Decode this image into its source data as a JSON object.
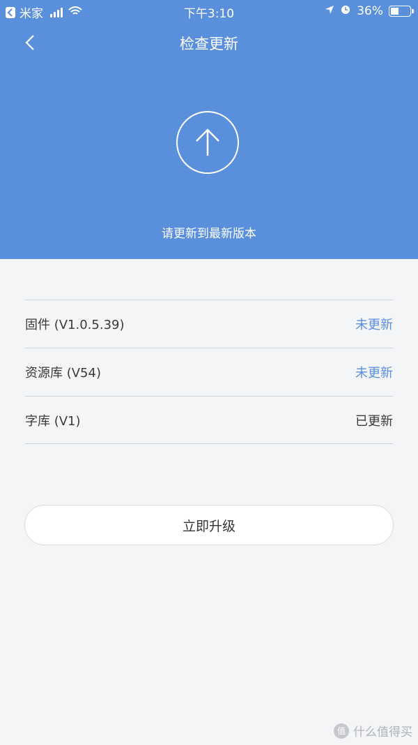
{
  "statusbar": {
    "back_app": "米家",
    "time": "下午3:10",
    "battery": "36%",
    "battery_level": 0.36
  },
  "nav": {
    "title": "检查更新"
  },
  "hero": {
    "hint": "请更新到最新版本"
  },
  "items": [
    {
      "name": "固件 (V1.0.5.39)",
      "status": "未更新",
      "updated": false
    },
    {
      "name": "资源库 (V54)",
      "status": "未更新",
      "updated": false
    },
    {
      "name": "字库 (V1)",
      "status": "已更新",
      "updated": true
    }
  ],
  "actions": {
    "upgrade_label": "立即升级"
  },
  "watermark": {
    "logo": "值",
    "text": "什么值得买"
  },
  "colors": {
    "accent": "#5a8fdc",
    "background": "#f4f5f7"
  }
}
